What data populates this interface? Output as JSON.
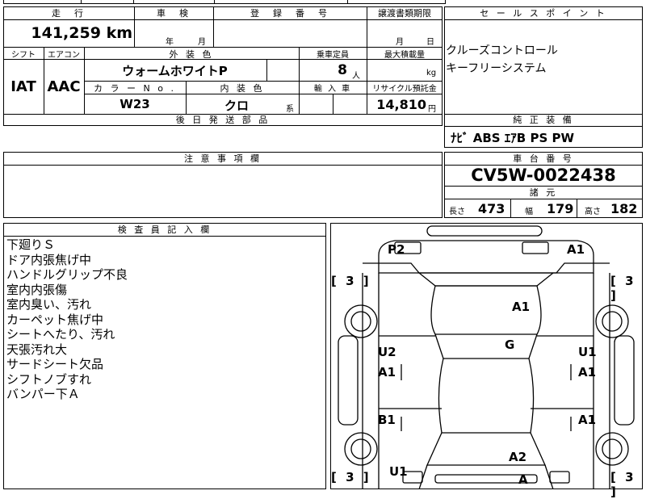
{
  "header": {
    "mileage_label": "走　行",
    "inspection_label": "車　検",
    "registration_label": "登　録　番　号",
    "transfer_docs_label": "譲渡書類期限",
    "sales_point_label": "セ ー ル ス ポ イ ン ト"
  },
  "mileage": {
    "value": "141,259",
    "unit": "km"
  },
  "inspection": {
    "year_unit": "年",
    "month_unit": "月"
  },
  "transfer_docs": {
    "month_unit": "月",
    "day_unit": "日"
  },
  "labels": {
    "shift": "シフト",
    "aircon": "エアコン",
    "exterior_color": "外 装 色",
    "capacity": "乗車定員",
    "max_load": "最大積載量",
    "color_no": "カ ラ ー N o .",
    "interior_color": "内 装 色",
    "import": "輸 入 車",
    "recycle_fee": "リサイクル預託金",
    "later_parts": "後 日 発 送 部 品",
    "remarks": "注 意 事 項 欄",
    "chassis_no": "車 台 番 号",
    "specs": "諸 元",
    "equipment": "純 正 装 備",
    "inspector_notes": "検 査 員 記 入 欄",
    "length": "長さ",
    "width": "幅",
    "height": "高さ"
  },
  "vehicle": {
    "shift": "IAT",
    "aircon": "AAC",
    "exterior_color": "ウォームホワイトP",
    "capacity": "8",
    "capacity_unit": "人",
    "load_unit": "kg",
    "color_no": "W23",
    "interior_color": "クロ",
    "interior_suffix": "系",
    "recycle_fee": "14,810",
    "recycle_unit": "円",
    "chassis_no": "CV5W-0022438",
    "length": "473",
    "width": "179",
    "height": "182"
  },
  "sales_points": [
    "クルーズコントロール",
    "キーフリーシステム"
  ],
  "equipment": "ﾅﾋﾞ ABS ｴｱB PS PW",
  "inspector_notes": [
    "下廻りＳ",
    "ドア内張焦げ中",
    "ハンドルグリップ不良",
    "室内内張傷",
    "室内臭い、汚れ",
    "カーペット焦げ中",
    "シートへたり、汚れ",
    "天張汚れ大",
    "サードシート欠品",
    "シフトノブすれ",
    "バンパー下Ａ"
  ],
  "diagram": {
    "marks": {
      "rear_left": "P2",
      "rear_right": "A1",
      "roof": "A1",
      "center": "G",
      "left_upper_label": "U2",
      "left_upper_grade": "A1",
      "right_upper_label": "U1",
      "right_upper_grade": "A1",
      "left_lower": "B1",
      "right_lower": "A1",
      "hood": "A2",
      "front_left": "U1",
      "front": "A"
    },
    "tires": [
      "[ 3 ]",
      "[ 3 ]",
      "[ 3 ]",
      "[ 3 ]"
    ]
  }
}
